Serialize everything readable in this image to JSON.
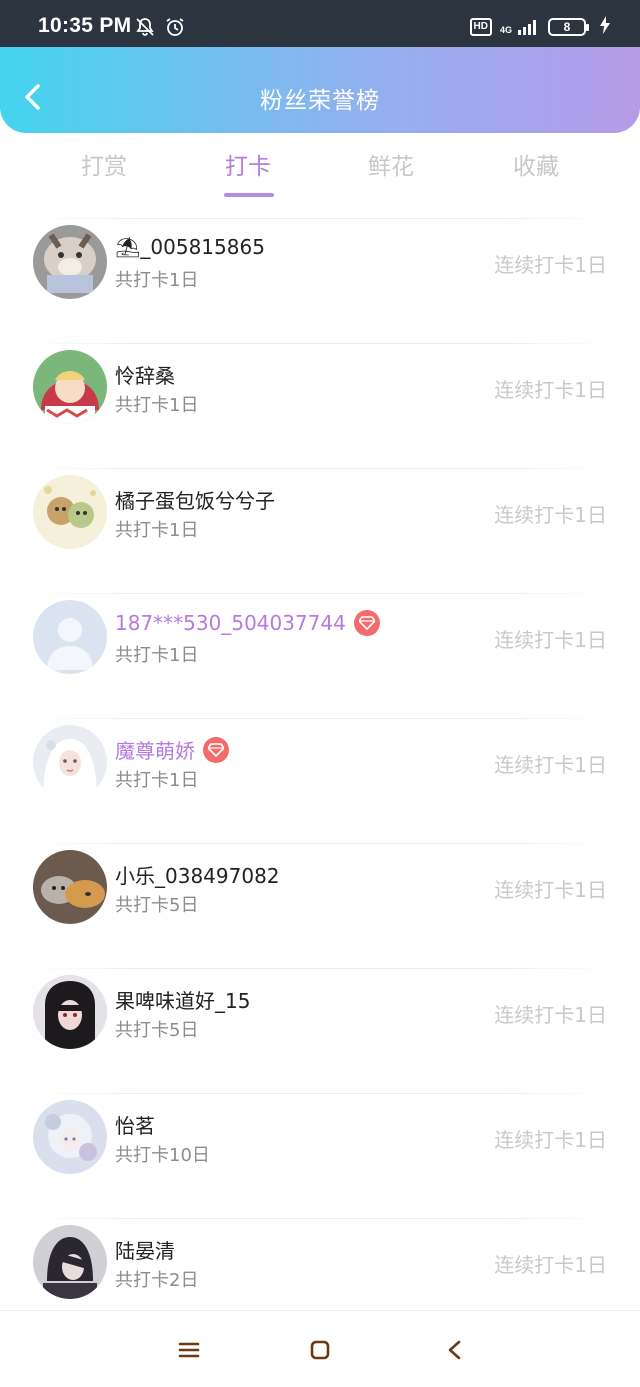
{
  "status_bar": {
    "time": "10:35 PM",
    "icons_left": [
      "bell-off-icon",
      "alarm-icon"
    ],
    "hd": "HD",
    "network": "4G",
    "battery": "8"
  },
  "header": {
    "title": "粉丝荣誉榜",
    "back_icon": "chevron-left-icon",
    "gradient": [
      "#43d4f0",
      "#b59be8"
    ]
  },
  "tabs": [
    {
      "label": "打赏",
      "active": false
    },
    {
      "label": "打卡",
      "active": true
    },
    {
      "label": "鲜花",
      "active": false
    },
    {
      "label": "收藏",
      "active": false
    }
  ],
  "accent_color": "#b07ee0",
  "fans": [
    {
      "name": "⛱_005815865",
      "total": "共打卡1日",
      "streak": "连续打卡1日",
      "vip": false
    },
    {
      "name": "怜辞桑",
      "total": "共打卡1日",
      "streak": "连续打卡1日",
      "vip": false
    },
    {
      "name": "橘子蛋包饭兮兮子",
      "total": "共打卡1日",
      "streak": "连续打卡1日",
      "vip": false
    },
    {
      "name": "187***530_504037744",
      "total": "共打卡1日",
      "streak": "连续打卡1日",
      "vip": true
    },
    {
      "name": "魔尊萌娇",
      "total": "共打卡1日",
      "streak": "连续打卡1日",
      "vip": true
    },
    {
      "name": "小乐_038497082",
      "total": "共打卡5日",
      "streak": "连续打卡1日",
      "vip": false
    },
    {
      "name": "果啤味道好_15",
      "total": "共打卡5日",
      "streak": "连续打卡1日",
      "vip": false
    },
    {
      "name": "怡茗",
      "total": "共打卡10日",
      "streak": "连续打卡1日",
      "vip": false
    },
    {
      "name": "陆晏清",
      "total": "共打卡2日",
      "streak": "连续打卡1日",
      "vip": false
    }
  ],
  "nav_bar": [
    "menu-icon",
    "home-square-icon",
    "back-triangle-icon"
  ]
}
